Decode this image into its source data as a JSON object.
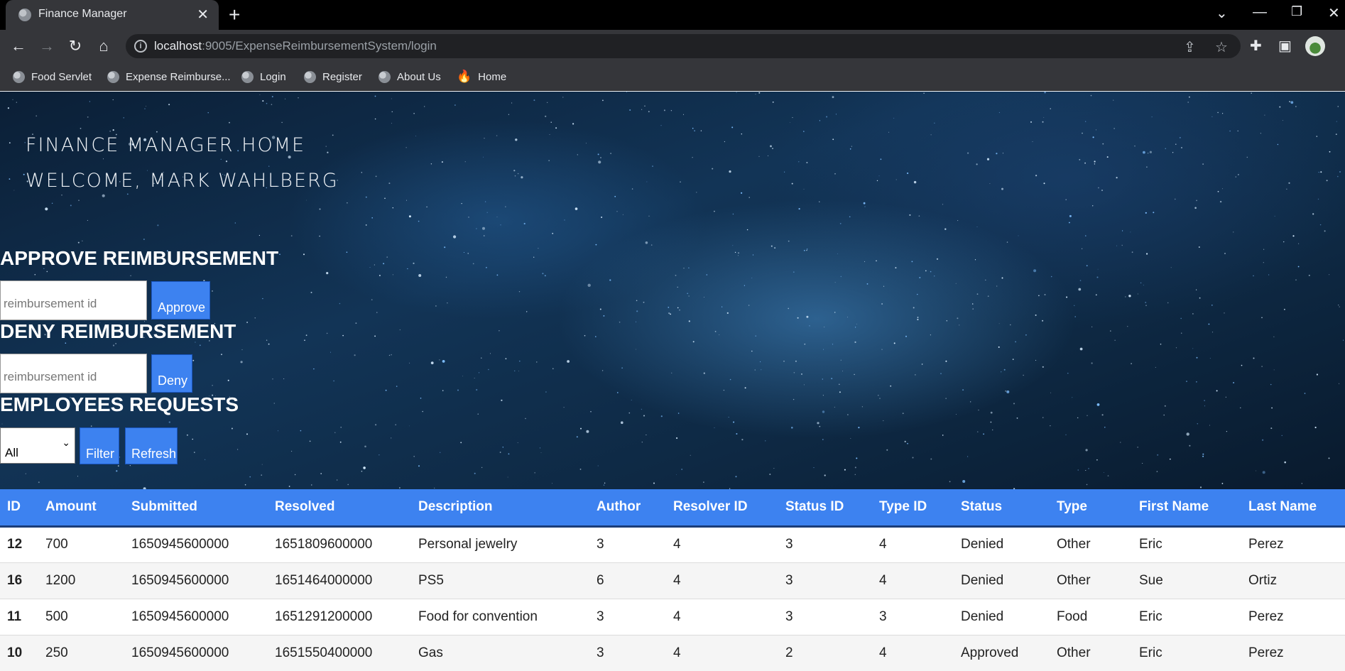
{
  "browser": {
    "tab_title": "Finance Manager",
    "url_host": "localhost",
    "url_rest": ":9005/ExpenseReimbursementSystem/login",
    "bookmarks": [
      {
        "label": "Food Servlet",
        "icon": "globe-icon"
      },
      {
        "label": "Expense Reimburse...",
        "icon": "globe-icon"
      },
      {
        "label": "Login",
        "icon": "globe-icon"
      },
      {
        "label": "Register",
        "icon": "globe-icon"
      },
      {
        "label": "About Us",
        "icon": "globe-icon"
      },
      {
        "label": "Home",
        "icon": "fire-icon"
      }
    ]
  },
  "header": {
    "title": "FINANCE MANAGER HOME",
    "welcome": "WELCOME, MARK WAHLBERG"
  },
  "approve": {
    "heading": "APPROVE REIMBURSEMENT",
    "placeholder": "reimbursement id",
    "button": "Approve"
  },
  "deny": {
    "heading": "DENY REIMBURSEMENT",
    "placeholder": "reimbursement id",
    "button": "Deny"
  },
  "requests": {
    "heading": "EMPLOYEES REQUESTS",
    "filter_selected": "All",
    "filter_button": "Filter",
    "refresh_button": "Refresh"
  },
  "table": {
    "columns": [
      "ID",
      "Amount",
      "Submitted",
      "Resolved",
      "Description",
      "Author",
      "Resolver ID",
      "Status ID",
      "Type ID",
      "Status",
      "Type",
      "First Name",
      "Last Name"
    ],
    "rows": [
      [
        "12",
        "700",
        "1650945600000",
        "1651809600000",
        "Personal jewelry",
        "3",
        "4",
        "3",
        "4",
        "Denied",
        "Other",
        "Eric",
        "Perez"
      ],
      [
        "16",
        "1200",
        "1650945600000",
        "1651464000000",
        "PS5",
        "6",
        "4",
        "3",
        "4",
        "Denied",
        "Other",
        "Sue",
        "Ortiz"
      ],
      [
        "11",
        "500",
        "1650945600000",
        "1651291200000",
        "Food for convention",
        "3",
        "4",
        "3",
        "3",
        "Denied",
        "Food",
        "Eric",
        "Perez"
      ],
      [
        "10",
        "250",
        "1650945600000",
        "1651550400000",
        "Gas",
        "3",
        "4",
        "2",
        "4",
        "Approved",
        "Other",
        "Eric",
        "Perez"
      ]
    ]
  },
  "colors": {
    "accent": "#3d82f0",
    "header_border": "#1b3d78"
  }
}
